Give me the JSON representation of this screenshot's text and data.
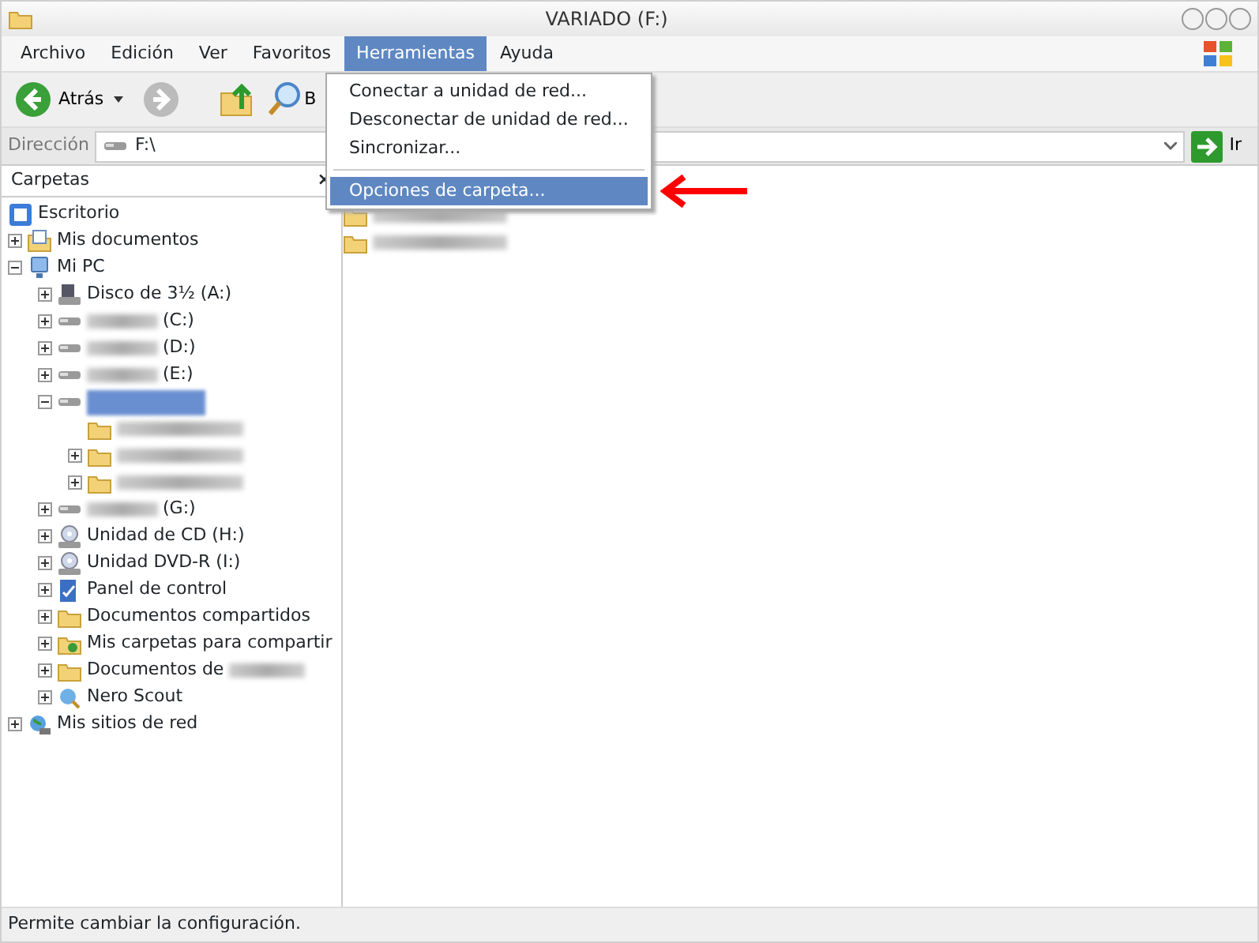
{
  "window": {
    "title": "VARIADO (F:)"
  },
  "menu_bar": [
    {
      "label": "Archivo",
      "selected": false
    },
    {
      "label": "Edición",
      "selected": false
    },
    {
      "label": "Ver",
      "selected": false
    },
    {
      "label": "Favoritos",
      "selected": false
    },
    {
      "label": "Herramientas",
      "selected": true
    },
    {
      "label": "Ayuda",
      "selected": false
    }
  ],
  "menu": {
    "items": [
      {
        "kind": "item",
        "label": "Conectar a unidad de red...",
        "selected": false
      },
      {
        "kind": "item",
        "label": "Desconectar de unidad de red...",
        "selected": false
      },
      {
        "kind": "item",
        "label": "Sincronizar...",
        "selected": false
      },
      {
        "kind": "separator"
      },
      {
        "kind": "item",
        "label": "Opciones de carpeta...",
        "selected": true
      }
    ]
  },
  "toolbar": {
    "back": {
      "label": "Atrás",
      "disabled": false
    },
    "forward": {
      "disabled": true
    },
    "search": {
      "label": "B"
    }
  },
  "address": {
    "label": "Dirección",
    "value": "F:\\",
    "go": "Ir"
  },
  "folders_pane": {
    "title": "Carpetas",
    "close": "×",
    "tree": [
      {
        "kind": "desktop",
        "label": "Escritorio",
        "selected": false,
        "children": [
          {
            "kind": "docs",
            "label": "Mis documentos",
            "expanded": false,
            "selected": false
          },
          {
            "kind": "pc",
            "label": "Mi PC",
            "expanded": true,
            "selected": false,
            "children": [
              {
                "kind": "floppy",
                "label": "Disco de 3½ (A:)",
                "expanded": false,
                "selected": false
              },
              {
                "kind": "drive",
                "label": "(C:)",
                "redacted_prefix": true,
                "expanded": false,
                "selected": false
              },
              {
                "kind": "drive",
                "label": "(D:)",
                "redacted_prefix": true,
                "expanded": false,
                "selected": false
              },
              {
                "kind": "drive",
                "label": "(E:)",
                "redacted_prefix": true,
                "expanded": false,
                "selected": false
              },
              {
                "kind": "drive",
                "redacted_prefix": true,
                "expanded": true,
                "selected": true,
                "children": [
                  {
                    "kind": "folder",
                    "redacted_prefix": true,
                    "selected": false
                  },
                  {
                    "kind": "folder",
                    "redacted_prefix": true,
                    "expanded": false,
                    "selected": false
                  },
                  {
                    "kind": "folder",
                    "redacted_prefix": true,
                    "expanded": false,
                    "selected": false
                  }
                ]
              },
              {
                "kind": "drive",
                "label": "(G:)",
                "redacted_prefix": true,
                "expanded": false,
                "selected": false
              },
              {
                "kind": "cd",
                "label": "Unidad de CD (H:)",
                "expanded": false,
                "selected": false
              },
              {
                "kind": "cd",
                "label": "Unidad DVD-R (I:)",
                "expanded": false,
                "selected": false
              },
              {
                "kind": "control",
                "label": "Panel de control",
                "expanded": false,
                "selected": false
              },
              {
                "kind": "folder",
                "label": "Documentos compartidos",
                "expanded": false,
                "selected": false
              },
              {
                "kind": "shared",
                "label": "Mis carpetas para compartir",
                "expanded": false,
                "selected": false
              },
              {
                "kind": "folder",
                "label": "Documentos de",
                "redacted_suffix": true,
                "expanded": false,
                "selected": false
              },
              {
                "kind": "nero",
                "label": "Nero Scout",
                "expanded": false,
                "selected": false
              }
            ]
          },
          {
            "kind": "network",
            "label": "Mis sitios de red",
            "expanded": false,
            "selected": false
          }
        ]
      }
    ]
  },
  "files": [
    {
      "kind": "folder",
      "redacted_prefix": true
    },
    {
      "kind": "folder",
      "redacted_prefix": true
    }
  ],
  "status_bar": {
    "text": "Permite cambiar la configuración."
  }
}
